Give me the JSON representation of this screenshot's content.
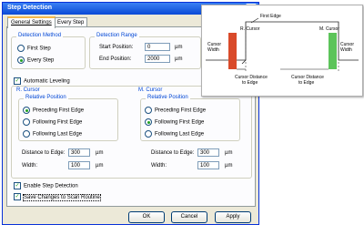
{
  "dialog": {
    "title": "Step Detection",
    "close_glyph": "✕"
  },
  "tabs": [
    {
      "label": "General Settings",
      "active": true
    },
    {
      "label": "Every Step",
      "active": false
    }
  ],
  "detection_method": {
    "label": "Detection Method",
    "options": [
      {
        "label": "First Step",
        "selected": false
      },
      {
        "label": "Every Step",
        "selected": true
      }
    ]
  },
  "detection_range": {
    "label": "Detection Range",
    "start_label": "Start Position:",
    "start_value": "0",
    "end_label": "End Position:",
    "end_value": "2000",
    "unit": "µm"
  },
  "automatic_leveling": {
    "label": "Automatic Leveling",
    "checked": true
  },
  "r_cursor": {
    "label": "R. Cursor",
    "relative_label": "Relative Position",
    "options": [
      {
        "label": "Preceding First Edge",
        "selected": true
      },
      {
        "label": "Following First Edge",
        "selected": false
      },
      {
        "label": "Following Last Edge",
        "selected": false
      }
    ],
    "distance_label": "Distance to Edge:",
    "distance_value": "300",
    "width_label": "Width:",
    "width_value": "100",
    "unit": "µm"
  },
  "m_cursor": {
    "label": "M. Cursor",
    "relative_label": "Relative Position",
    "options": [
      {
        "label": "Preceding First Edge",
        "selected": false
      },
      {
        "label": "Following First Edge",
        "selected": true
      },
      {
        "label": "Following Last Edge",
        "selected": false
      }
    ],
    "distance_label": "Distance to Edge:",
    "distance_value": "300",
    "width_label": "Width:",
    "width_value": "100",
    "unit": "µm"
  },
  "enable_step_detection": {
    "label": "Enable Step Detection",
    "checked": true
  },
  "save_changes": {
    "label": "Save Changes to Scan Routine",
    "checked": true
  },
  "buttons": {
    "ok": "OK",
    "cancel": "Cancel",
    "apply": "Apply"
  },
  "diagram": {
    "r_cursor_label": "R. Cursor",
    "first_edge_label": "First Edge",
    "m_cursor_label": "M. Cursor",
    "cursor_width_left": [
      "Cursor",
      "Width"
    ],
    "cursor_width_right": [
      "Cursor",
      "Width"
    ],
    "distance_left": [
      "Cursor Distance",
      "to Edge"
    ],
    "distance_right": [
      "Cursor Distance",
      "to Edge"
    ],
    "colors": {
      "r_cursor": "#d94a2a",
      "m_cursor": "#5cc45a"
    }
  }
}
